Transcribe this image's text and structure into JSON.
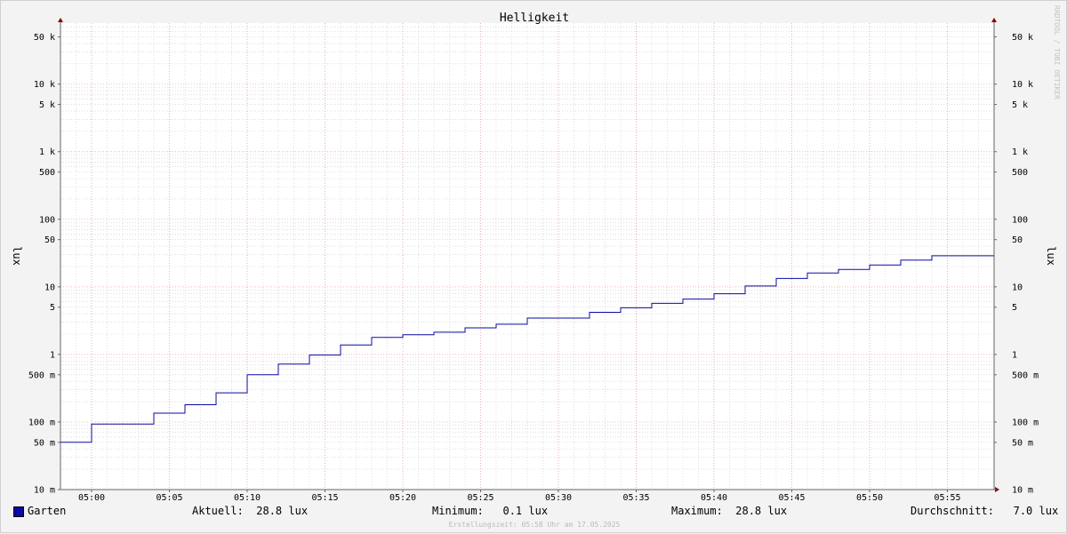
{
  "chart_data": {
    "type": "line",
    "title": "Helligkeit",
    "ylabel_left": "lux",
    "ylabel_right": "lux",
    "yscale": "log",
    "ylim": [
      0.01,
      80000
    ],
    "xlim": [
      "04:58",
      "05:58"
    ],
    "x_ticks": [
      "05:00",
      "05:05",
      "05:10",
      "05:15",
      "05:20",
      "05:25",
      "05:30",
      "05:35",
      "05:40",
      "05:45",
      "05:50",
      "05:55"
    ],
    "y_ticks": [
      {
        "value": 50000,
        "label": "50 k"
      },
      {
        "value": 10000,
        "label": "10 k"
      },
      {
        "value": 5000,
        "label": "5 k"
      },
      {
        "value": 1000,
        "label": "1 k"
      },
      {
        "value": 500,
        "label": "500"
      },
      {
        "value": 100,
        "label": "100"
      },
      {
        "value": 50,
        "label": "50"
      },
      {
        "value": 10,
        "label": "10"
      },
      {
        "value": 5,
        "label": "5"
      },
      {
        "value": 1,
        "label": "1"
      },
      {
        "value": 0.5,
        "label": "500 m"
      },
      {
        "value": 0.1,
        "label": "100 m"
      },
      {
        "value": 0.05,
        "label": "50 m"
      },
      {
        "value": 0.01,
        "label": "10 m"
      }
    ],
    "grid": true,
    "series": [
      {
        "name": "Garten",
        "color": "#0a0aa5",
        "step": true,
        "x": [
          "04:58",
          "05:00",
          "05:04",
          "05:06",
          "05:08",
          "05:10",
          "05:12",
          "05:14",
          "05:16",
          "05:18",
          "05:20",
          "05:22",
          "05:24",
          "05:26",
          "05:28",
          "05:32",
          "05:34",
          "05:36",
          "05:38",
          "05:40",
          "05:42",
          "05:44",
          "05:46",
          "05:48",
          "05:50",
          "05:52",
          "05:54",
          "05:58"
        ],
        "y": [
          0.05,
          0.093,
          0.135,
          0.18,
          0.27,
          0.5,
          0.72,
          0.98,
          1.38,
          1.78,
          1.96,
          2.13,
          2.47,
          2.8,
          3.45,
          4.2,
          4.9,
          5.7,
          6.6,
          7.9,
          10.3,
          13.3,
          16.0,
          18.1,
          21.0,
          24.8,
          28.8,
          28.8
        ]
      }
    ]
  },
  "legend": {
    "series_name": "Garten",
    "current": "Aktuell:  28.8 lux",
    "minimum": "Minimum:   0.1 lux",
    "maximum": "Maximum:  28.8 lux",
    "average": "Durchschnitt:   7.0 lux"
  },
  "footer": "Erstellungszeit: 05:58 Uhr am 17.05.2025",
  "watermark": "RRDTOOL / TOBI OETIKER",
  "colors": {
    "background": "#f3f3f3",
    "plot_background": "#ffffff",
    "major_grid": "#e8a0a0",
    "minor_grid": "#cccccc",
    "series": "#0a0aa5",
    "arrow": "#8b0000"
  }
}
